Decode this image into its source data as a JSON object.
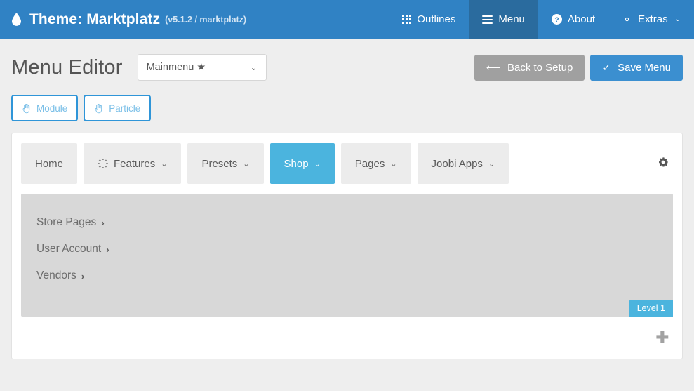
{
  "topbar": {
    "logo_icon": "water-drop-icon",
    "title": "Theme: Marktplatz",
    "version": "(v5.1.2 / marktplatz)",
    "nav": [
      {
        "label": "Outlines",
        "icon": "grid-icon",
        "active": false,
        "caret": ""
      },
      {
        "label": "Menu",
        "icon": "hamburger-icon",
        "active": true,
        "caret": ""
      },
      {
        "label": "About",
        "icon": "question-circle-icon",
        "active": false,
        "caret": ""
      },
      {
        "label": "Extras",
        "icon": "gear-icon",
        "active": false,
        "caret": "⌄"
      }
    ],
    "colors": {
      "background": "#3082c4",
      "active": "#2a6b9e"
    }
  },
  "header": {
    "page_title": "Menu Editor",
    "menu_select": {
      "value": "Mainmenu ★",
      "caret": "⌄"
    },
    "back_button": {
      "label": "Back to Setup",
      "icon": "arrow-left-icon",
      "color": "#a0a0a0"
    },
    "save_button": {
      "label": "Save Menu",
      "icon": "check-icon",
      "color": "#3b8fd0"
    }
  },
  "sources": [
    {
      "label": "Module",
      "icon": "hand-icon"
    },
    {
      "label": "Particle",
      "icon": "hand-icon"
    }
  ],
  "builder": {
    "tabs": [
      {
        "label": "Home",
        "icon": "",
        "caret": "",
        "active": false
      },
      {
        "label": "Features",
        "icon": "spinner-icon",
        "caret": "⌄",
        "active": false
      },
      {
        "label": "Presets",
        "icon": "",
        "caret": "⌄",
        "active": false
      },
      {
        "label": "Shop",
        "icon": "",
        "caret": "⌄",
        "active": true
      },
      {
        "label": "Pages",
        "icon": "",
        "caret": "⌄",
        "active": false
      },
      {
        "label": "Joobi Apps",
        "icon": "",
        "caret": "⌄",
        "active": false
      }
    ],
    "settings_icon": "gear-icon",
    "submenu": {
      "items": [
        {
          "label": "Store Pages",
          "caret": "›"
        },
        {
          "label": "User Account",
          "caret": "›"
        },
        {
          "label": "Vendors",
          "caret": "›"
        }
      ],
      "level_badge": "Level 1",
      "badge_color": "#4bb4de"
    },
    "add_button": "✚",
    "active_tab_color": "#4bb4de"
  }
}
